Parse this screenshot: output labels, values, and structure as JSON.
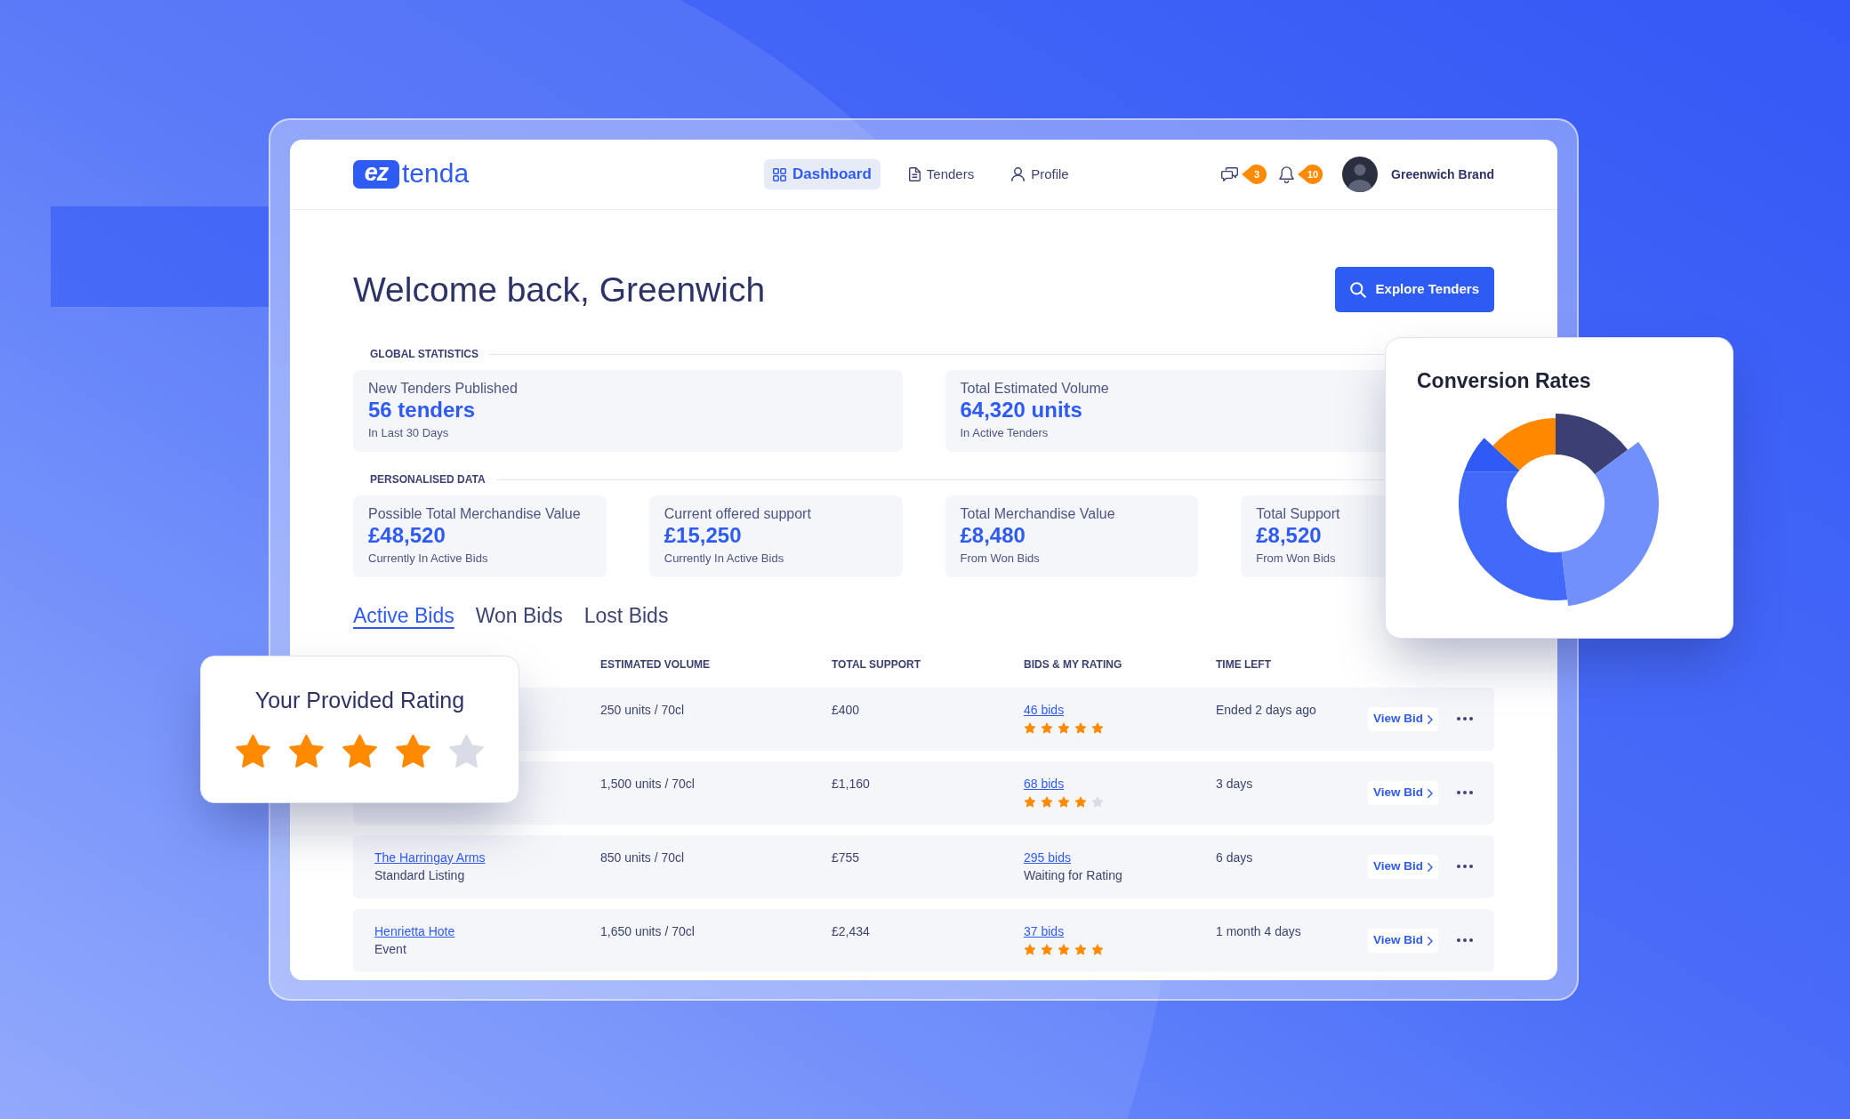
{
  "logo": {
    "mark": "ez",
    "name": "tenda"
  },
  "nav": [
    {
      "label": "Dashboard",
      "selected": true
    },
    {
      "label": "Tenders",
      "selected": false
    },
    {
      "label": "Profile",
      "selected": false
    }
  ],
  "header_actions": [
    {
      "badge": "3"
    },
    {
      "badge": "10"
    }
  ],
  "user": {
    "name": "Greenwich Brand"
  },
  "welcome": {
    "title": "Welcome back, Greenwich",
    "button": "Explore Tenders"
  },
  "stat_sections": [
    {
      "heading": "GLOBAL STATISTICS",
      "cards": [
        {
          "label": "New Tenders Published",
          "value": "56 tenders",
          "note": "In Last 30 Days"
        },
        {
          "label": "Total Estimated Volume",
          "value": "64,320 units",
          "note": "In Active Tenders"
        }
      ]
    },
    {
      "heading": "PERSONALISED DATA",
      "cards": [
        {
          "label": "Possible Total Merchandise Value",
          "value": "£48,520",
          "note": "Currently In Active Bids"
        },
        {
          "label": "Current offered support",
          "value": "£15,250",
          "note": "Currently In Active Bids"
        },
        {
          "label": "Total Merchandise Value",
          "value": "£8,480",
          "note": "From Won Bids"
        },
        {
          "label": "Total Support",
          "value": "£8,520",
          "note": "From Won Bids"
        }
      ]
    }
  ],
  "bid_tabs": [
    {
      "label": "Active Bids",
      "selected": true
    },
    {
      "label": "Won Bids",
      "selected": false
    },
    {
      "label": "Lost Bids",
      "selected": false
    }
  ],
  "table": {
    "columns": [
      "ESTIMATED VOLUME",
      "TOTAL SUPPORT",
      "BIDS & MY RATING",
      "TIME LEFT"
    ],
    "rows": [
      {
        "volume": "250 units / 70cl",
        "support": "£400",
        "bids": "46 bids",
        "rating": {
          "kind": "stars",
          "stars": 5
        },
        "time_left": "Ended 2 days ago",
        "action": "View Bid"
      },
      {
        "volume": "1,500 units / 70cl",
        "support": "£1,160",
        "bids": "68 bids",
        "rating": {
          "kind": "stars",
          "stars": 4
        },
        "time_left": "3 days",
        "action": "View Bid"
      },
      {
        "venue": "The Harringay Arms",
        "listing": "Standard Listing",
        "volume": "850 units / 70cl",
        "support": "£755",
        "bids": "295 bids",
        "rating": {
          "kind": "note",
          "text": "Waiting for Rating"
        },
        "time_left": "6 days",
        "action": "View Bid"
      },
      {
        "venue": "Henrietta Hote",
        "listing": "Event",
        "volume": "1,650 units / 70cl",
        "support": "£2,434",
        "bids": "37 bids",
        "rating": {
          "kind": "stars",
          "stars": 5
        },
        "time_left": "1 month 4 days",
        "action": "View Bid"
      }
    ]
  },
  "rating_card": {
    "title": "Your Provided Rating",
    "stars": 4
  },
  "conversion_card": {
    "title": "Conversion Rates"
  }
}
